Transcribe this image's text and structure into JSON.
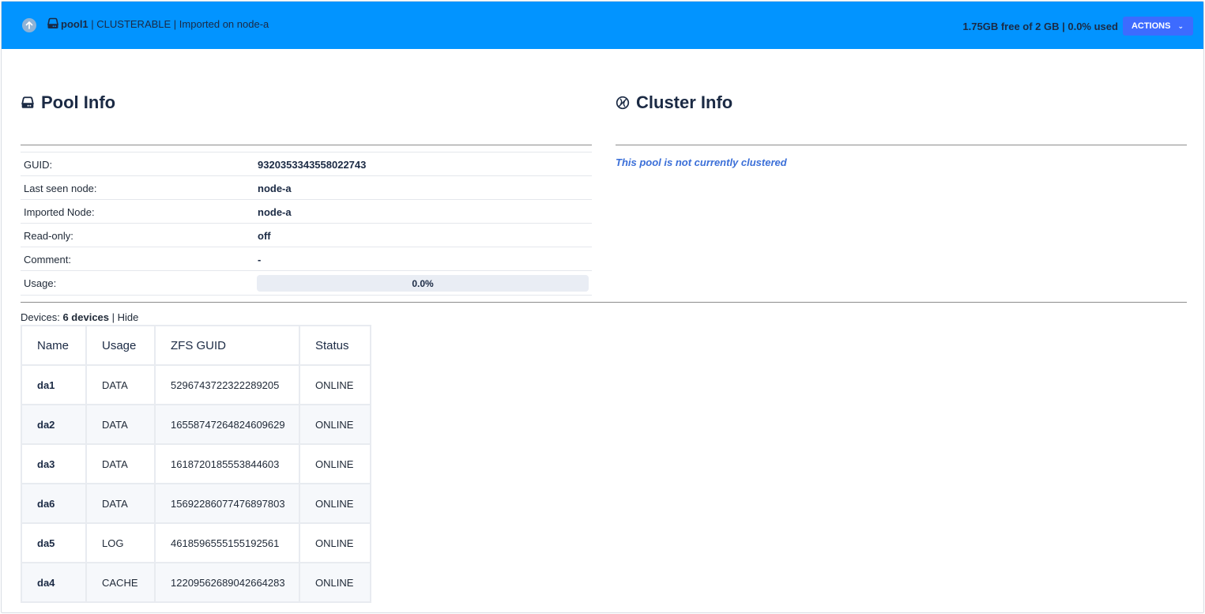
{
  "header": {
    "pool_name": "pool1",
    "subtitle": " | CLUSTERABLE | Imported on node-a",
    "capacity": "1.75GB free of 2 GB | 0.0% used",
    "actions_label": "ACTIONS",
    "bg_color": "#0294ff",
    "actions_color": "#3d6bff"
  },
  "pool_info": {
    "title": "Pool Info",
    "rows": [
      {
        "label": "GUID:",
        "value": "9320353343558022743"
      },
      {
        "label": "Last seen node:",
        "value": "node-a"
      },
      {
        "label": "Imported Node:",
        "value": "node-a"
      },
      {
        "label": "Read-only:",
        "value": "off"
      },
      {
        "label": "Comment:",
        "value": "-"
      }
    ],
    "usage_label": "Usage:",
    "usage_text": "0.0%",
    "usage_fraction": 0.0
  },
  "cluster_info": {
    "title": "Cluster Info",
    "message": "This pool is not currently clustered"
  },
  "devices": {
    "prefix": "Devices: ",
    "count": "6 devices",
    "separator": " | ",
    "hide_label": "Hide",
    "headers": [
      "Name",
      "Usage",
      "ZFS GUID",
      "Status"
    ],
    "rows": [
      {
        "name": "da1",
        "usage": "DATA",
        "guid": "5296743722322289205",
        "status": "ONLINE"
      },
      {
        "name": "da2",
        "usage": "DATA",
        "guid": "16558747264824609629",
        "status": "ONLINE"
      },
      {
        "name": "da3",
        "usage": "DATA",
        "guid": "1618720185553844603",
        "status": "ONLINE"
      },
      {
        "name": "da6",
        "usage": "DATA",
        "guid": "15692286077476897803",
        "status": "ONLINE"
      },
      {
        "name": "da5",
        "usage": "LOG",
        "guid": "4618596555155192561",
        "status": "ONLINE"
      },
      {
        "name": "da4",
        "usage": "CACHE",
        "guid": "12209562689042664283",
        "status": "ONLINE"
      }
    ]
  }
}
